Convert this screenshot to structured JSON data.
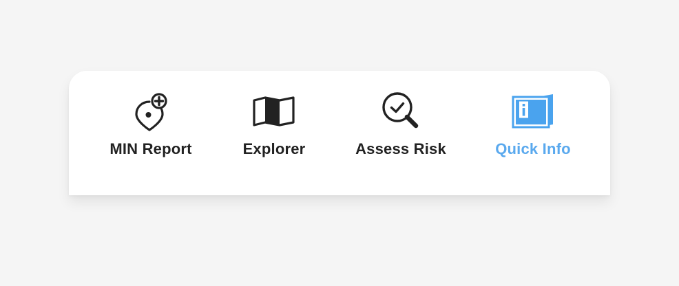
{
  "tabbar": {
    "active_color": "#5aa9ee",
    "text_color": "#222222",
    "items": [
      {
        "label": "MIN Report",
        "icon": "map-pin-plus-icon",
        "active": false
      },
      {
        "label": "Explorer",
        "icon": "map-icon",
        "active": false
      },
      {
        "label": "Assess Risk",
        "icon": "search-check-icon",
        "active": false
      },
      {
        "label": "Quick Info",
        "icon": "info-book-icon",
        "active": true
      }
    ]
  }
}
